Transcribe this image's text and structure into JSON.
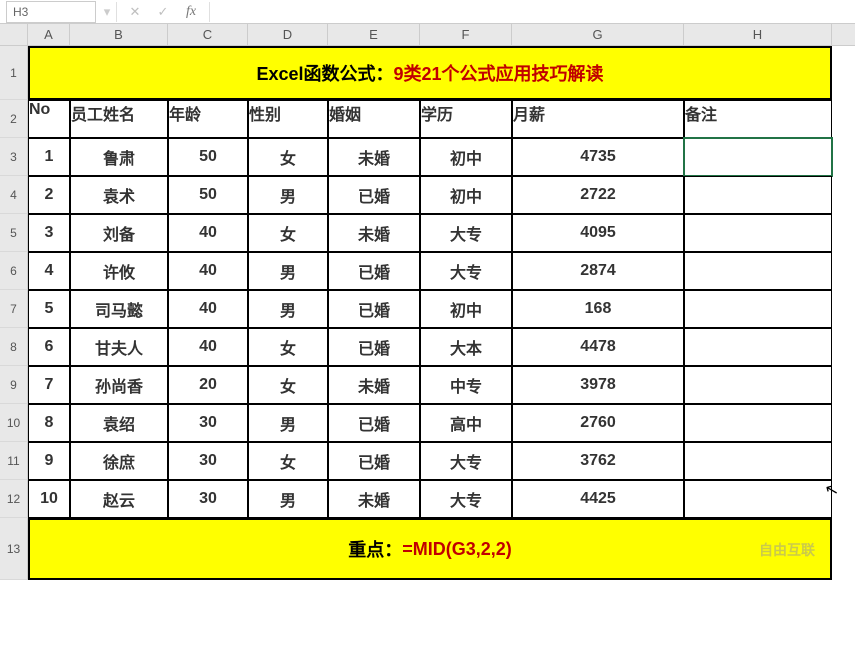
{
  "nameBox": "H3",
  "formulaInput": "",
  "colLabels": [
    "A",
    "B",
    "C",
    "D",
    "E",
    "F",
    "G",
    "H"
  ],
  "rowLabels": [
    "1",
    "2",
    "3",
    "4",
    "5",
    "6",
    "7",
    "8",
    "9",
    "10",
    "11",
    "12",
    "13"
  ],
  "titleRow": {
    "prefix": "Excel函数公式：",
    "main": "9类21个公式应用技巧解读"
  },
  "headers": [
    "No",
    "员工姓名",
    "年龄",
    "性别",
    "婚姻",
    "学历",
    "月薪",
    "备注"
  ],
  "rows": [
    {
      "no": "1",
      "name": "鲁肃",
      "age": "50",
      "gender": "女",
      "marriage": "未婚",
      "edu": "初中",
      "salary": "4735",
      "note": ""
    },
    {
      "no": "2",
      "name": "袁术",
      "age": "50",
      "gender": "男",
      "marriage": "已婚",
      "edu": "初中",
      "salary": "2722",
      "note": ""
    },
    {
      "no": "3",
      "name": "刘备",
      "age": "40",
      "gender": "女",
      "marriage": "未婚",
      "edu": "大专",
      "salary": "4095",
      "note": ""
    },
    {
      "no": "4",
      "name": "许攸",
      "age": "40",
      "gender": "男",
      "marriage": "已婚",
      "edu": "大专",
      "salary": "2874",
      "note": ""
    },
    {
      "no": "5",
      "name": "司马懿",
      "age": "40",
      "gender": "男",
      "marriage": "已婚",
      "edu": "初中",
      "salary": "168",
      "note": ""
    },
    {
      "no": "6",
      "name": "甘夫人",
      "age": "40",
      "gender": "女",
      "marriage": "已婚",
      "edu": "大本",
      "salary": "4478",
      "note": ""
    },
    {
      "no": "7",
      "name": "孙尚香",
      "age": "20",
      "gender": "女",
      "marriage": "未婚",
      "edu": "中专",
      "salary": "3978",
      "note": ""
    },
    {
      "no": "8",
      "name": "袁绍",
      "age": "30",
      "gender": "男",
      "marriage": "已婚",
      "edu": "高中",
      "salary": "2760",
      "note": ""
    },
    {
      "no": "9",
      "name": "徐庶",
      "age": "30",
      "gender": "女",
      "marriage": "已婚",
      "edu": "大专",
      "salary": "3762",
      "note": ""
    },
    {
      "no": "10",
      "name": "赵云",
      "age": "30",
      "gender": "男",
      "marriage": "未婚",
      "edu": "大专",
      "salary": "4425",
      "note": ""
    }
  ],
  "footer": {
    "label": "重点：",
    "formula": "=MID(G3,2,2)"
  },
  "watermark": "自由互联"
}
